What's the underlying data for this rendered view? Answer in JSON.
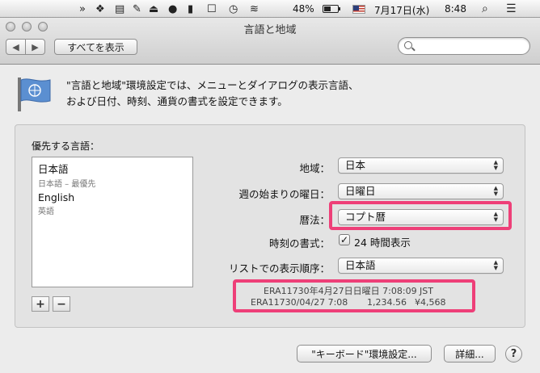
{
  "menubar": {
    "icons": [
      "airplay-icon",
      "dropbox-icon",
      "printer-icon",
      "notes-icon",
      "eject-icon",
      "alert-icon",
      "bookmark-icon",
      "checkbox-icon",
      "time-machine-icon",
      "wifi-icon"
    ],
    "battery_percent": "48%",
    "date": "7月17日(水)",
    "time": "8:48"
  },
  "window": {
    "title": "言語と地域",
    "show_all": "すべてを表示",
    "back": "◀",
    "forward": "▶",
    "search_placeholder": ""
  },
  "intro": {
    "line1": "\"言語と地域\"環境設定では、メニューとダイアログの表示言語、",
    "line2": "および日付、時刻、通貨の書式を設定できます。"
  },
  "languages": {
    "label": "優先する言語：",
    "items": [
      {
        "name": "日本語",
        "sub": "日本語 – 最優先"
      },
      {
        "name": "English",
        "sub": "英語"
      }
    ],
    "add": "+",
    "remove": "−"
  },
  "settings": {
    "region_label": "地域：",
    "region_value": "日本",
    "first_day_label": "週の始まりの曜日：",
    "first_day_value": "日曜日",
    "calendar_label": "暦法：",
    "calendar_value": "コプト暦",
    "time_format_label": "時刻の書式：",
    "time_format_check": "✓",
    "time_format_value": "24 時間表示",
    "sort_order_label": "リストでの表示順序：",
    "sort_order_value": "日本語"
  },
  "sample": {
    "line1": "ERA11730年4月27日日曜日 7:08:09 JST",
    "line2_date": "ERA11730/04/27 7:08",
    "line2_number": "1,234.56",
    "line2_currency": "¥4,568"
  },
  "footer": {
    "keyboard": "\"キーボード\"環境設定...",
    "advanced": "詳細...",
    "help": "?"
  },
  "colors": {
    "highlight": "#ee3f78"
  }
}
